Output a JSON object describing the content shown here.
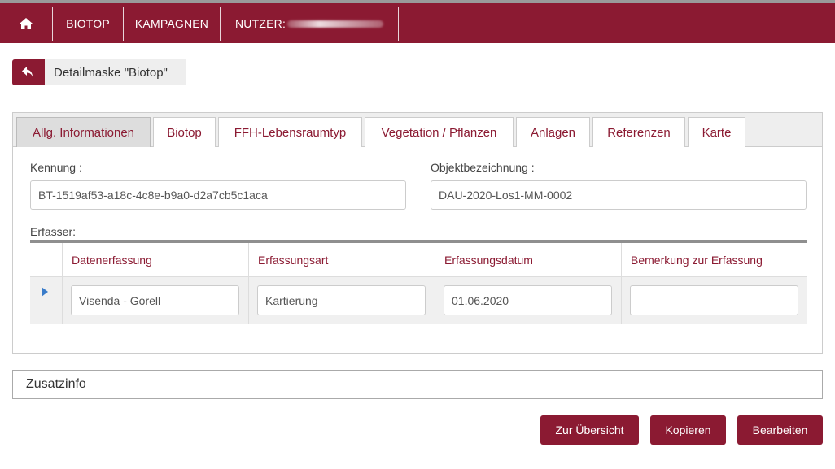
{
  "nav": {
    "home_icon": "home-icon",
    "items": [
      {
        "label": "BIOTOP"
      },
      {
        "label": "KAMPAGNEN"
      },
      {
        "label": "NUTZER:"
      }
    ]
  },
  "header": {
    "back_icon": "back-arrow-icon",
    "title": "Detailmaske \"Biotop\""
  },
  "tabs": [
    {
      "label": "Allg. Informationen",
      "active": true
    },
    {
      "label": "Biotop"
    },
    {
      "label": "FFH-Lebensraumtyp"
    },
    {
      "label": "Vegetation / Pflanzen"
    },
    {
      "label": "Anlagen"
    },
    {
      "label": "Referenzen"
    },
    {
      "label": "Karte"
    }
  ],
  "general": {
    "kennung_label": "Kennung :",
    "kennung_value": "BT-1519af53-a18c-4c8e-b9a0-d2a7cb5c1aca",
    "objekt_label": "Objektbezeichnung :",
    "objekt_value": "DAU-2020-Los1-MM-0002",
    "erfasser_label": "Erfasser:"
  },
  "erfasser_table": {
    "columns": [
      "Datenerfassung",
      "Erfassungsart",
      "Erfassungsdatum",
      "Bemerkung zur Erfassung"
    ],
    "rows": [
      [
        "Visenda - Gorell",
        "Kartierung",
        "01.06.2020",
        ""
      ]
    ]
  },
  "zusatzinfo": {
    "label": "Zusatzinfo"
  },
  "actions": {
    "overview": "Zur Übersicht",
    "copy": "Kopieren",
    "edit": "Bearbeiten"
  },
  "colors": {
    "brand": "#8b1a32",
    "tab_bar": "#eeeeee"
  }
}
